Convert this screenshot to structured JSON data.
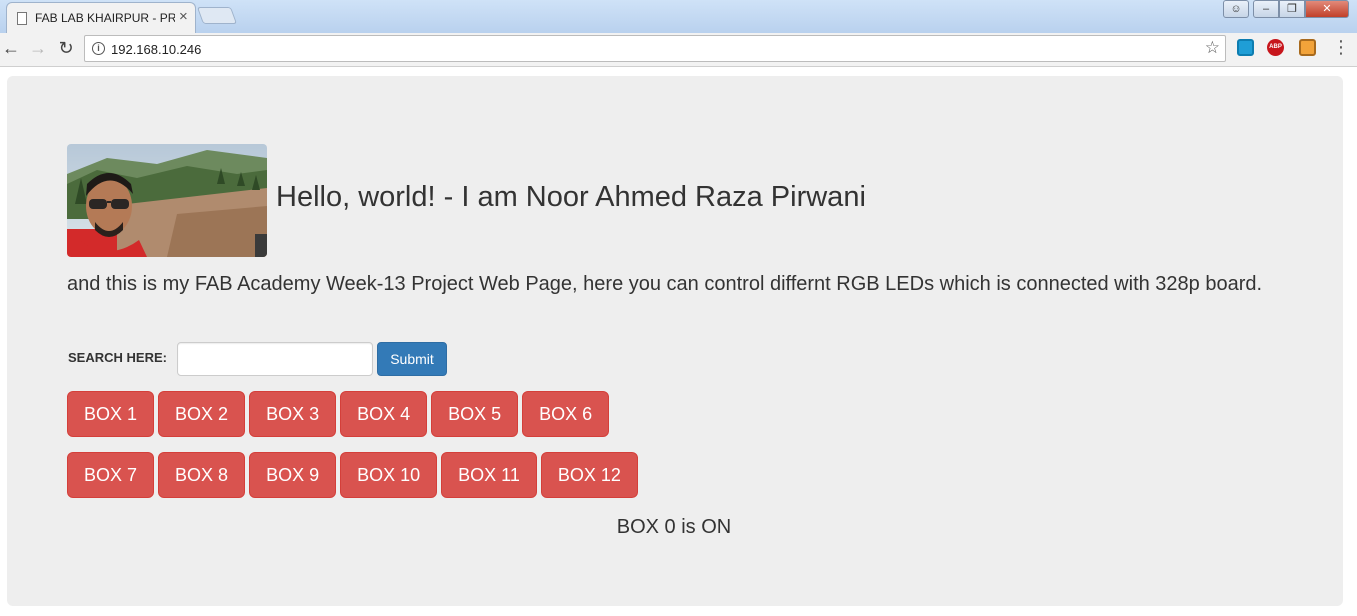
{
  "browser": {
    "tab_title": "FAB LAB KHAIRPUR - PROJECT",
    "tab_close_glyph": "×",
    "url": "192.168.10.246",
    "icons": {
      "back": "back-arrow-icon",
      "forward": "forward-arrow-icon",
      "reload": "reload-icon",
      "info": "info-icon",
      "bookmark": "star-icon",
      "menu": "kebab-menu-icon"
    },
    "extensions": {
      "abp_label": "ABP"
    }
  },
  "page": {
    "headline": "Hello, world! - I am Noor Ahmed Raza Pirwani",
    "lead": "and this is my FAB Academy Week-13 Project Web Page, here you can control differnt RGB LEDs which is connected with 328p board.",
    "search": {
      "label": "SEARCH HERE:",
      "value": "",
      "submit_label": "Submit"
    },
    "boxes_row1": [
      "BOX 1",
      "BOX 2",
      "BOX 3",
      "BOX 4",
      "BOX 5",
      "BOX 6"
    ],
    "boxes_row2": [
      "BOX 7",
      "BOX 8",
      "BOX 9",
      "BOX 10",
      "BOX 11",
      "BOX 12"
    ],
    "status": "BOX 0 is ON"
  },
  "colors": {
    "jumbotron_bg": "#eeeeee",
    "primary": "#337ab7",
    "danger": "#d9534f"
  }
}
